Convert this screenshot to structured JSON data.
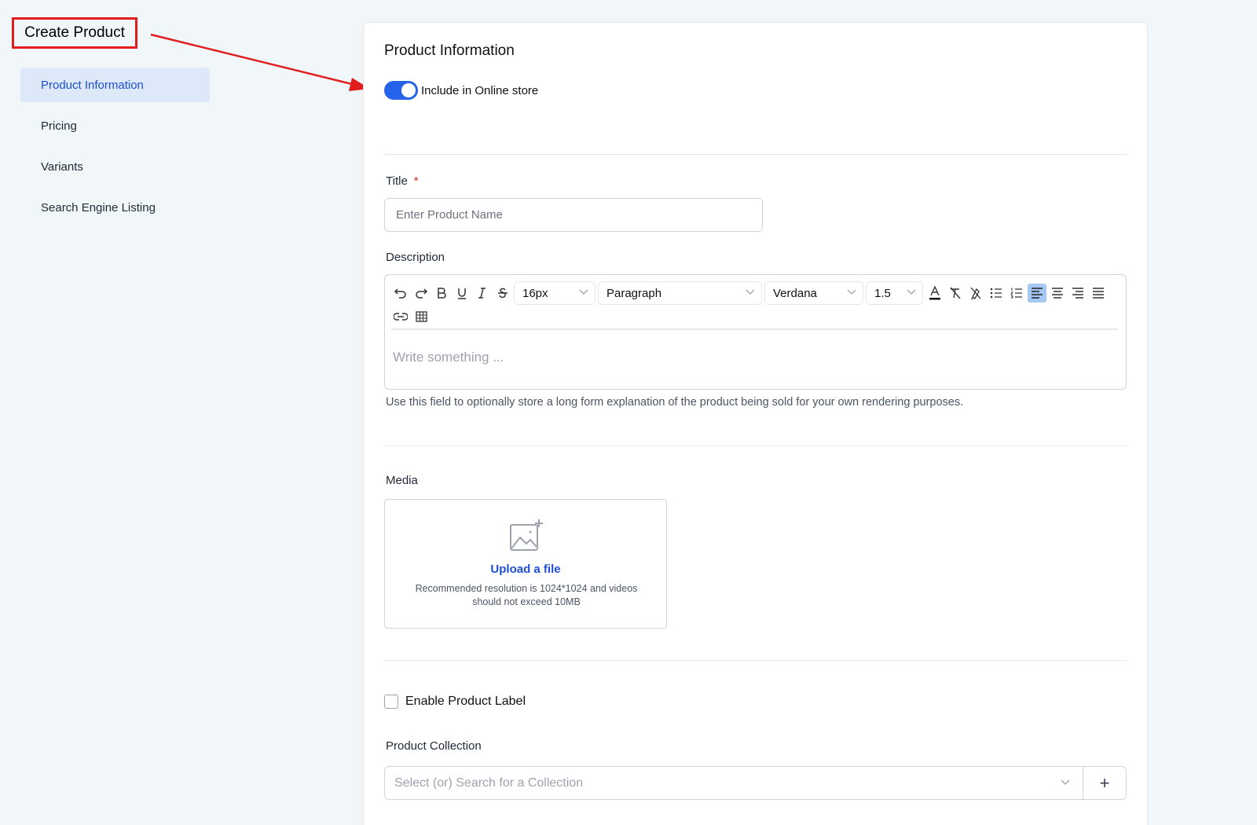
{
  "page": {
    "title": "Create Product"
  },
  "sidebar": {
    "items": [
      {
        "label": "Product Information",
        "active": true
      },
      {
        "label": "Pricing",
        "active": false
      },
      {
        "label": "Variants",
        "active": false
      },
      {
        "label": "Search Engine Listing",
        "active": false
      }
    ]
  },
  "product_info": {
    "heading": "Product Information",
    "online_store_toggle": {
      "label": "Include in Online store",
      "on": true
    },
    "title_field": {
      "label": "Title",
      "required_mark": "*",
      "placeholder": "Enter Product Name",
      "value": ""
    },
    "description": {
      "label": "Description",
      "font_size": "16px",
      "block_format": "Paragraph",
      "font_family": "Verdana",
      "line_height": "1.5",
      "placeholder": "Write something ...",
      "helper": "Use this field to optionally store a long form explanation of the product being sold for your own rendering purposes."
    },
    "media": {
      "label": "Media",
      "upload_link": "Upload a file",
      "hint": "Recommended resolution is 1024*1024 and videos should not exceed 10MB"
    },
    "product_label": {
      "label": "Enable Product Label",
      "checked": false
    },
    "collection": {
      "label": "Product Collection",
      "placeholder": "Select (or) Search for a Collection",
      "add_symbol": "+"
    }
  },
  "colors": {
    "accent": "#2563eb",
    "annotation": "#e11d1d",
    "background": "#f1f6f9"
  }
}
